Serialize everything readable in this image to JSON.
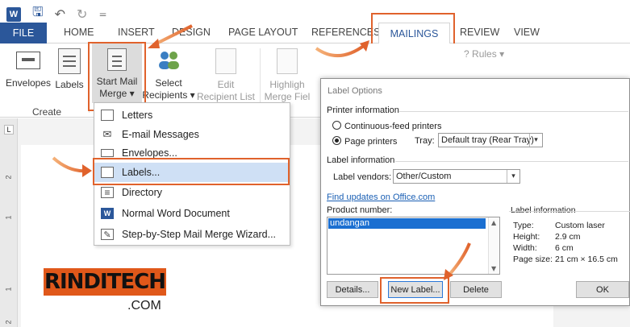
{
  "qat": {
    "word_logo": "W",
    "save": "🖫",
    "undo": "↶",
    "redo": "↻",
    "more": "="
  },
  "tabs": [
    "FILE",
    "HOME",
    "INSERT",
    "DESIGN",
    "PAGE LAYOUT",
    "REFERENCES",
    "MAILINGS",
    "REVIEW",
    "VIEW"
  ],
  "ribbon": {
    "envelopes": "Envelopes",
    "labels": "Labels",
    "start_mail_merge_1": "Start Mail",
    "start_mail_merge_2": "Merge",
    "select_recipients_1": "Select",
    "select_recipients_2": "Recipients",
    "edit_recipient_1": "Edit",
    "edit_recipient_2": "Recipient List",
    "highlight_1": "Highligh",
    "highlight_2": "Merge Fiel",
    "rules": "Rules",
    "group_create": "Create",
    "dropdown_caret": "▾"
  },
  "ruler_marks": [
    "2",
    "1",
    "1",
    "2"
  ],
  "ruler_corner": "L",
  "menu": {
    "items": [
      {
        "label": "Letters",
        "icon": "letter-icon",
        "glyph": ""
      },
      {
        "label": "E-mail Messages",
        "icon": "email-icon",
        "glyph": "✉"
      },
      {
        "label": "Envelopes...",
        "icon": "envelope-icon",
        "glyph": ""
      },
      {
        "label": "Labels...",
        "icon": "labels-icon",
        "glyph": ""
      },
      {
        "label": "Directory",
        "icon": "directory-icon",
        "glyph": "≡"
      },
      {
        "label": "Normal Word Document",
        "icon": "word-doc-icon",
        "glyph": "W"
      },
      {
        "label": "Step-by-Step Mail Merge Wizard...",
        "icon": "wizard-icon",
        "glyph": "✎"
      }
    ]
  },
  "logo": {
    "text": "RINDITECH",
    "suffix": ".COM"
  },
  "dialog": {
    "title": "Label Options",
    "printer_info": "Printer information",
    "continuous": "Continuous-feed printers",
    "page_printers": "Page printers",
    "tray_label": "Tray:",
    "tray_value": "Default tray (Rear Tray)",
    "label_info": "Label information",
    "vendors_label": "Label vendors:",
    "vendors_value": "Other/Custom",
    "find_updates": "Find updates on Office.com",
    "product_number": "Product number:",
    "product_selected": "undangan",
    "label_information_title": "Label information",
    "info_rows": [
      {
        "key": "Type:",
        "value": "Custom laser"
      },
      {
        "key": "Height:",
        "value": "2.9 cm"
      },
      {
        "key": "Width:",
        "value": "6 cm"
      },
      {
        "key": "Page size:",
        "value": "21 cm × 16.5 cm"
      }
    ],
    "btn_details": "Details...",
    "btn_new_label": "New Label...",
    "btn_delete": "Delete",
    "btn_ok": "OK"
  },
  "colors": {
    "accent": "#2b579a",
    "highlight": "#e0622c",
    "selection": "#cfe0f5"
  }
}
